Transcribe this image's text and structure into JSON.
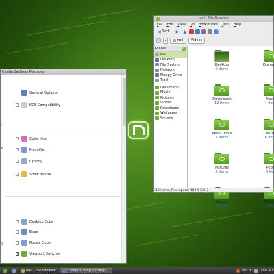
{
  "file_browser": {
    "title": "neil - File Browser",
    "menu": [
      "File",
      "Edit",
      "View",
      "Go",
      "Bookmarks",
      "Tabs",
      "Help"
    ],
    "back_label": "Back",
    "path_buttons": [
      "neil",
      "Videos"
    ],
    "sidebar_header": "Places",
    "places": [
      {
        "label": "neil",
        "selected": true,
        "color": "#a8a8a8"
      },
      {
        "label": "Desktop",
        "color": "#4a7db8"
      },
      {
        "label": "File System",
        "color": "#888888"
      },
      {
        "label": "Network",
        "color": "#6b8fc7"
      },
      {
        "label": "Floppy Drive",
        "color": "#777777"
      },
      {
        "label": "Trash",
        "color": "#999999"
      }
    ],
    "bookmarks": [
      "Documents",
      "Music",
      "Pictures",
      "Videos",
      "Downloads",
      "Wallpaper",
      "Sounds"
    ],
    "folders": [
      {
        "name": "Desktop",
        "count": "0 items",
        "desktop": true
      },
      {
        "name": "Documen",
        "count": ""
      },
      {
        "name": "Downloads",
        "count": "12 items"
      },
      {
        "name": "Frostbi",
        "count": "4 items"
      },
      {
        "name": "Menu Icons",
        "count": "6 items"
      },
      {
        "name": "Music",
        "count": "6 items"
      },
      {
        "name": "Pictures",
        "count": "6 items"
      },
      {
        "name": "Public",
        "count": "0 item"
      },
      {
        "name": "Sounds",
        "count": "1 item"
      },
      {
        "name": "Templat",
        "count": "0 item"
      }
    ],
    "status": [
      "12 items, Free space: 100.9 GB"
    ]
  },
  "compiz": {
    "title": "Config Settings Manager",
    "plugins": [
      {
        "label": "General Options",
        "checkbox": false,
        "color": "#5a7fb5"
      },
      {
        "label": "KDE Compatibility",
        "checkbox": true,
        "checked": false,
        "color": "#cccccc"
      },
      {
        "label": "Color filter",
        "checkbox": true,
        "checked": false,
        "color": "#d06fbf"
      },
      {
        "label": "Magnifier",
        "checkbox": true,
        "checked": false,
        "color": "#7c9bcf"
      },
      {
        "label": "Opacify",
        "checkbox": true,
        "checked": false,
        "color": "#9aa9c2"
      },
      {
        "label": "Show mouse",
        "checkbox": true,
        "checked": false,
        "color": "#e3b94a"
      },
      {
        "label": "Desktop Cube",
        "checkbox": true,
        "checked": false,
        "color": "#8aa4c8"
      },
      {
        "label": "Expo",
        "checkbox": true,
        "checked": false,
        "color": "#6e8cbc"
      },
      {
        "label": "Rotate Cube",
        "checkbox": true,
        "checked": false,
        "color": "#7f9fd0"
      },
      {
        "label": "Viewport Switcher",
        "checkbox": true,
        "checked": true,
        "color": "#7aa64a"
      }
    ],
    "left_labels": [
      "t",
      "e",
      "p"
    ]
  },
  "taskbar": {
    "tasks": [
      {
        "label": "neil - File Browser",
        "active": false
      },
      {
        "label": "CompizConfig Settings...",
        "active": true
      }
    ],
    "temp": "82 °F",
    "clock": "Thu Au"
  }
}
